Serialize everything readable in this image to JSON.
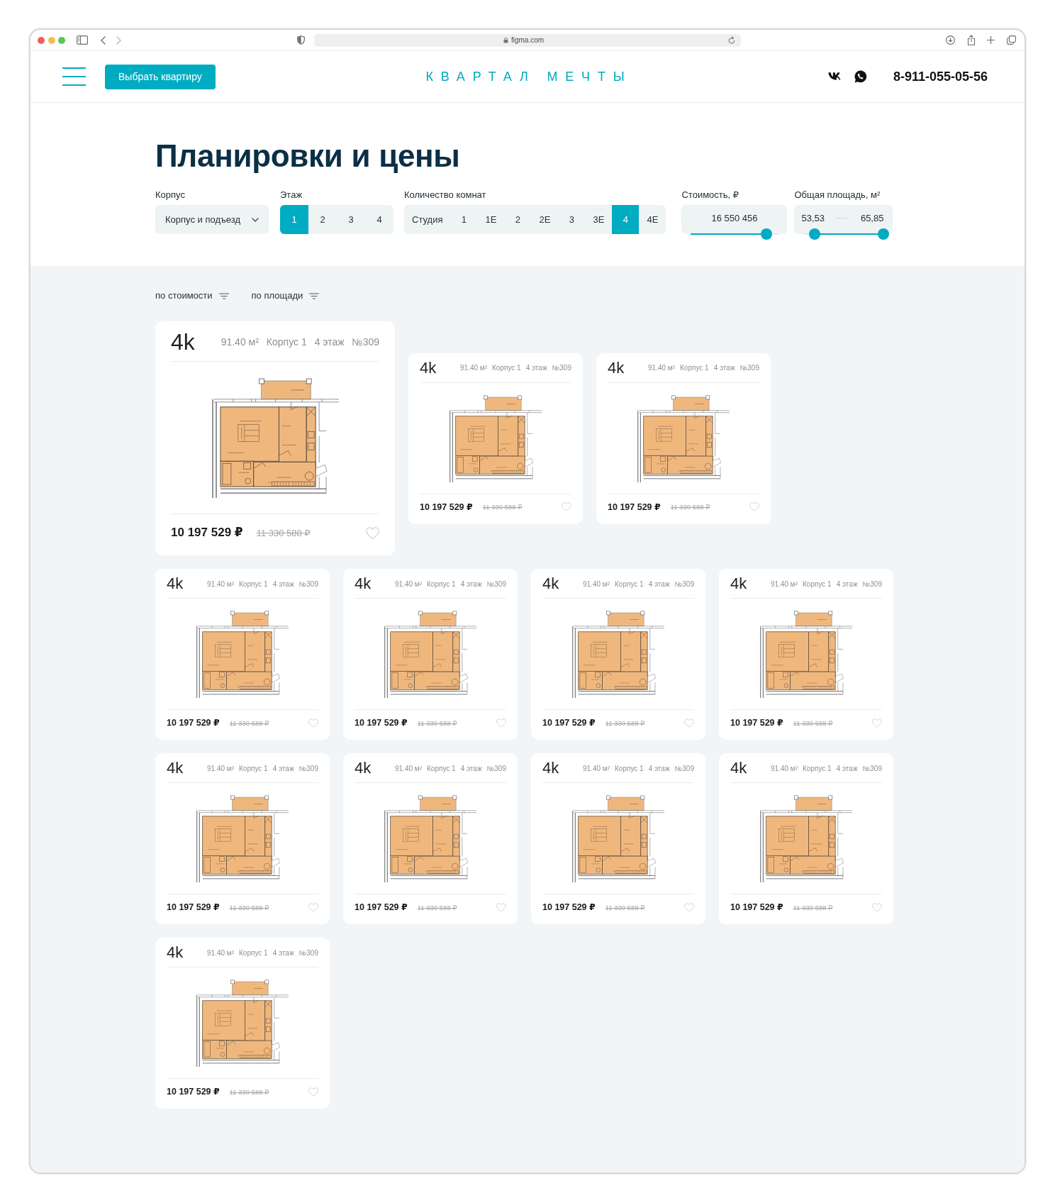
{
  "browser": {
    "url": "figma.com"
  },
  "header": {
    "button": "Выбрать квартиру",
    "logo": "КВАРТАЛ МЕЧТЫ",
    "phone": "8-911-055-05-56"
  },
  "title": "Планировки и цены",
  "filters": [
    {
      "kind": "dropdown",
      "label": "Корпус",
      "value": "Корпус и подъезд"
    },
    {
      "kind": "segments",
      "label": "Этаж",
      "options": [
        {
          "label": "1",
          "selected": true
        },
        {
          "label": "2",
          "selected": false
        },
        {
          "label": "3",
          "selected": false
        },
        {
          "label": "4",
          "selected": false
        }
      ]
    },
    {
      "kind": "segments",
      "label": "Количество комнат",
      "options": [
        {
          "label": "Студия",
          "selected": false
        },
        {
          "label": "1",
          "selected": false
        },
        {
          "label": "1Е",
          "selected": false
        },
        {
          "label": "2",
          "selected": false
        },
        {
          "label": "2Е",
          "selected": false
        },
        {
          "label": "3",
          "selected": false
        },
        {
          "label": "3Е",
          "selected": false
        },
        {
          "label": "4",
          "selected": true
        },
        {
          "label": "4Е",
          "selected": false
        }
      ]
    },
    {
      "kind": "slider",
      "label": "Стоимость, ₽",
      "value": "16 550 456",
      "level": 0.86
    },
    {
      "kind": "range",
      "label": "Общая площадь, м²",
      "min": "53,53",
      "max": "65,85",
      "handles": [
        {
          "level": 0.14
        },
        {
          "level": 1
        }
      ]
    }
  ],
  "sort": [
    {
      "label": "по стоимости"
    },
    {
      "label": "по площади"
    }
  ],
  "cards": [
    {
      "kind": "large",
      "rooms": "4k",
      "area": "91.40 м²",
      "building": "Корпус 1",
      "floor": "4 этаж",
      "number": "№309",
      "price": "10 197 529 ₽",
      "old_price": "11 330 588 ₽",
      "favorite": false
    },
    {
      "kind": "compact",
      "rooms": "4k",
      "area": "91.40 м²",
      "building": "Корпус 1",
      "floor": "4 этаж",
      "number": "№309",
      "price": "10 197 529 ₽",
      "old_price": "11 330 588 ₽",
      "favorite": false
    },
    {
      "kind": "compact",
      "rooms": "4k",
      "area": "91.40 м²",
      "building": "Корпус 1",
      "floor": "4 этаж",
      "number": "№309",
      "price": "10 197 529 ₽",
      "old_price": "11 330 588 ₽",
      "favorite": false
    },
    {
      "kind": "compact",
      "rooms": "4k",
      "area": "91.40 м²",
      "building": "Корпус 1",
      "floor": "4 этаж",
      "number": "№309",
      "price": "10 197 529 ₽",
      "old_price": "11 330 588 ₽",
      "favorite": false
    },
    {
      "kind": "compact",
      "rooms": "4k",
      "area": "91.40 м²",
      "building": "Корпус 1",
      "floor": "4 этаж",
      "number": "№309",
      "price": "10 197 529 ₽",
      "old_price": "11 330 588 ₽",
      "favorite": false
    },
    {
      "kind": "compact",
      "rooms": "4k",
      "area": "91.40 м²",
      "building": "Корпус 1",
      "floor": "4 этаж",
      "number": "№309",
      "price": "10 197 529 ₽",
      "old_price": "11 330 588 ₽",
      "favorite": false
    },
    {
      "kind": "compact",
      "rooms": "4k",
      "area": "91.40 м²",
      "building": "Корпус 1",
      "floor": "4 этаж",
      "number": "№309",
      "price": "10 197 529 ₽",
      "old_price": "11 330 588 ₽",
      "favorite": false
    },
    {
      "kind": "compact",
      "rooms": "4k",
      "area": "91.40 м²",
      "building": "Корпус 1",
      "floor": "4 этаж",
      "number": "№309",
      "price": "10 197 529 ₽",
      "old_price": "11 330 588 ₽",
      "favorite": false
    },
    {
      "kind": "compact",
      "rooms": "4k",
      "area": "91.40 м²",
      "building": "Корпус 1",
      "floor": "4 этаж",
      "number": "№309",
      "price": "10 197 529 ₽",
      "old_price": "11 330 588 ₽",
      "favorite": false
    },
    {
      "kind": "compact",
      "rooms": "4k",
      "area": "91.40 м²",
      "building": "Корпус 1",
      "floor": "4 этаж",
      "number": "№309",
      "price": "10 197 529 ₽",
      "old_price": "11 330 588 ₽",
      "favorite": false
    },
    {
      "kind": "compact",
      "rooms": "4k",
      "area": "91.40 м²",
      "building": "Корпус 1",
      "floor": "4 этаж",
      "number": "№309",
      "price": "10 197 529 ₽",
      "old_price": "11 330 588 ₽",
      "favorite": false
    },
    {
      "kind": "compact",
      "rooms": "4k",
      "area": "91.40 м²",
      "building": "Корпус 1",
      "floor": "4 этаж",
      "number": "№309",
      "price": "10 197 529 ₽",
      "old_price": "11 330 588 ₽",
      "favorite": false
    }
  ]
}
